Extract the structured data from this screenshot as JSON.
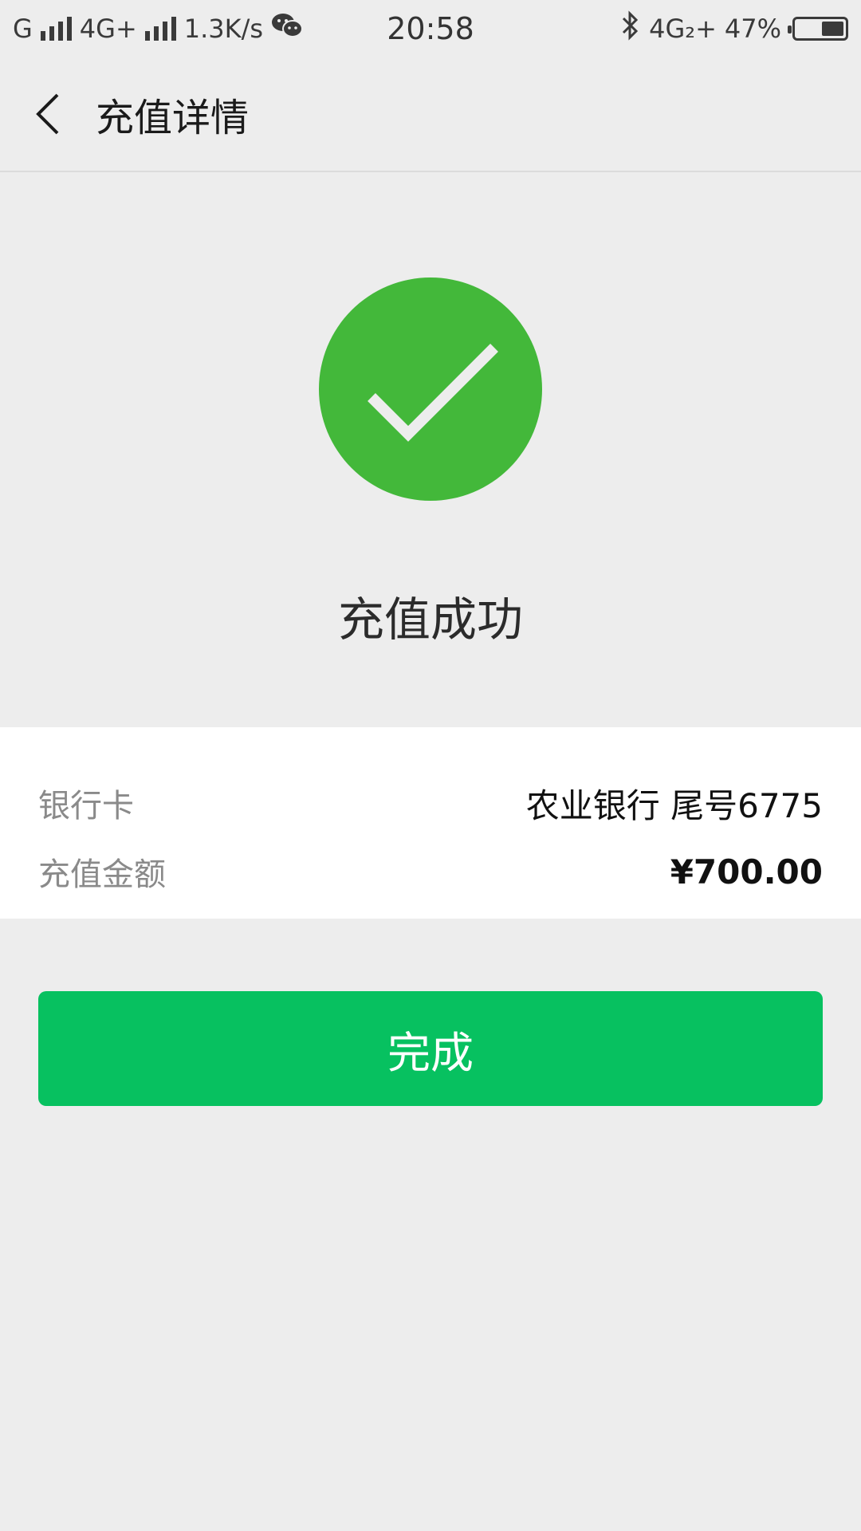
{
  "status_bar": {
    "carrier1": "G",
    "carrier2": "4G+",
    "speed": "1.3K/s",
    "time": "20:58",
    "network_right": "4G₂+",
    "battery_text": "47%",
    "battery_level": 0.47,
    "icons": [
      "signal-icon",
      "wechat-icon",
      "bluetooth-icon",
      "battery-icon"
    ]
  },
  "header": {
    "title": "充值详情",
    "back_icon": "chevron-left-icon"
  },
  "success": {
    "icon": "check-circle-icon",
    "icon_color": "#43B83A",
    "message": "充值成功"
  },
  "info": {
    "rows": [
      {
        "label": "银行卡",
        "value": "农业银行 尾号6775"
      },
      {
        "label": "充值金额",
        "value": "¥700.00"
      }
    ]
  },
  "actions": {
    "done_label": "完成",
    "done_color": "#07C160"
  }
}
